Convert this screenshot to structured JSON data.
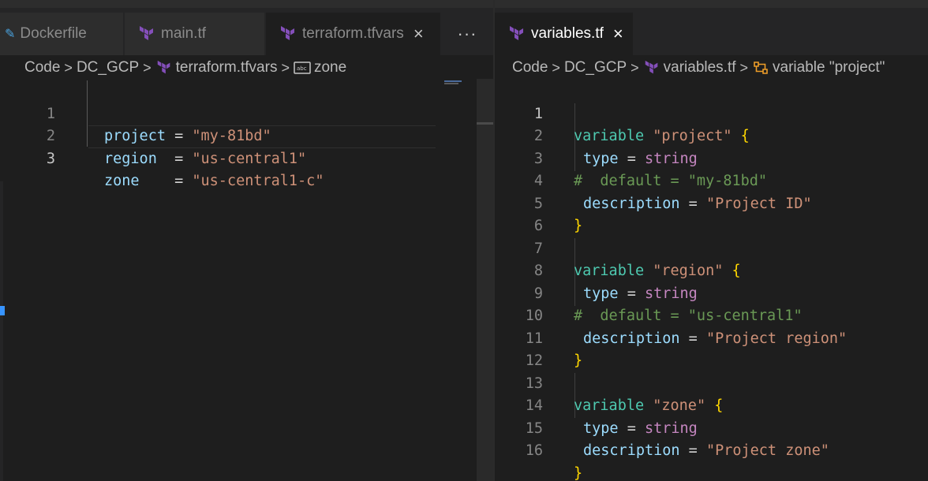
{
  "left_pane": {
    "tabs": [
      {
        "label": "Dockerfile",
        "icon": "docker-file-icon",
        "active": false
      },
      {
        "label": "main.tf",
        "icon": "terraform-icon",
        "active": false
      },
      {
        "label": "terraform.tfvars",
        "icon": "terraform-icon",
        "active": true,
        "close": "×"
      }
    ],
    "more_label": "···",
    "breadcrumb": {
      "items": [
        "Code",
        "DC_GCP",
        "terraform.tfvars",
        "zone"
      ],
      "separator": ">",
      "symbol_icon": "string-symbol-icon"
    },
    "lines": [
      {
        "num": "1",
        "key": "project",
        "pad": " = ",
        "value": "\"my-81bd\""
      },
      {
        "num": "2",
        "key": "region",
        "pad": "  = ",
        "value": "\"us-central1\""
      },
      {
        "num": "3",
        "key": "zone",
        "pad": "    = ",
        "value": "\"us-central1-c\""
      }
    ]
  },
  "right_pane": {
    "tab": {
      "label": "variables.tf",
      "icon": "terraform-icon",
      "close": "×"
    },
    "breadcrumb": {
      "items": [
        "Code",
        "DC_GCP",
        "variables.tf",
        "variable \"project\""
      ],
      "separator": ">",
      "symbol_icon": "variable-symbol-icon"
    },
    "line_numbers": [
      "1",
      "2",
      "3",
      "4",
      "5",
      "6",
      "7",
      "8",
      "9",
      "10",
      "11",
      "12",
      "13",
      "14",
      "15",
      "16"
    ],
    "blocks": [
      {
        "kw": "variable",
        "name": "\"project\"",
        "open": "{",
        "type_key": "type",
        "eq": "=",
        "type_val": "string",
        "comment": "#  default = \"my-81bd\"",
        "desc_key": "description",
        "desc_val": "\"Project ID\"",
        "close": "}"
      },
      {
        "kw": "variable",
        "name": "\"region\"",
        "open": "{",
        "type_key": "type",
        "eq": "=",
        "type_val": "string",
        "comment": "#  default = \"us-central1\"",
        "desc_key": "description",
        "desc_val": "\"Project region\"",
        "close": "}"
      },
      {
        "kw": "variable",
        "name": "\"zone\"",
        "open": "{",
        "type_key": "type",
        "eq": "=",
        "type_val": "string",
        "desc_key": "description",
        "desc_val": "\"Project zone\"",
        "close": "}"
      }
    ]
  },
  "colors": {
    "background": "#1e1e1e",
    "tabbar": "#252526",
    "keyword": "#4ec9b0",
    "string": "#ce9178",
    "attribute": "#9cdcfe",
    "type": "#c586c0",
    "brace": "#ffd700",
    "comment": "#6a9955",
    "terraform_purple": "#844fba"
  }
}
